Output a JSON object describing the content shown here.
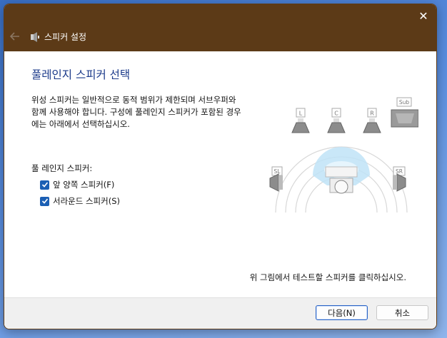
{
  "window": {
    "title": "스피커 설정",
    "close_glyph": "✕",
    "title_bar_color": "#5c3a17"
  },
  "content": {
    "heading": "풀레인지 스피커 선택",
    "description": "위성 스피커는 일반적으로 동적 범위가 제한되며 서브우퍼와 함께 사용해야 합니다. 구성에 풀레인지 스피커가 포함된 경우에는 아래에서 선택하십시오.",
    "group_label": "풀 레인지 스피커:",
    "checkboxes": [
      {
        "label": "앞 양쪽 스피커(F)",
        "checked": true
      },
      {
        "label": "서라운드 스피커(S)",
        "checked": true
      }
    ],
    "hint": "위 그림에서 테스트할 스피커를 클릭하십시오."
  },
  "diagram": {
    "speakers": {
      "left": "L",
      "center": "C",
      "right": "R",
      "sub": "Sub",
      "surround_left": "SL",
      "surround_right": "SR"
    }
  },
  "buttons": {
    "next": "다음(N)",
    "cancel": "취소"
  },
  "colors": {
    "accent": "#1b5fb4",
    "heading": "#1b3a8a"
  }
}
